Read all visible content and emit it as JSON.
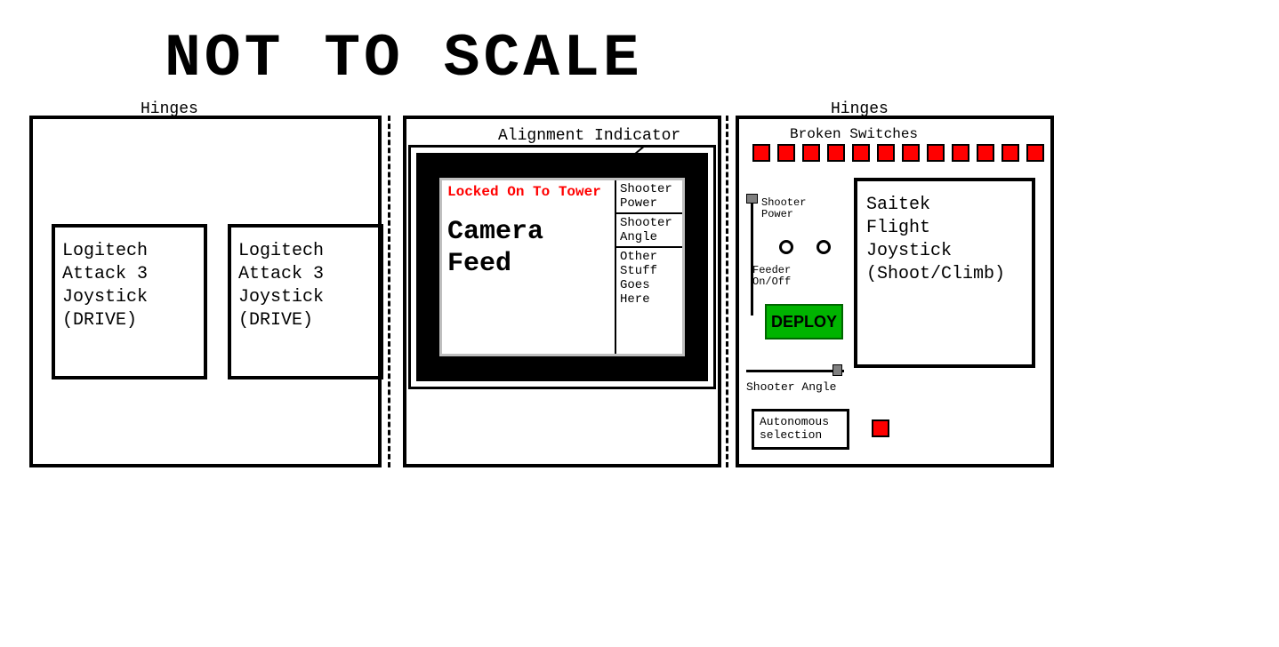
{
  "title": "NOT TO SCALE",
  "hinges_label": "Hinges",
  "joystick_drive": "Logitech\nAttack 3\nJoystick\n(DRIVE)",
  "center": {
    "align_label": "Alignment Indicator",
    "locked": "Locked On To Tower",
    "camera_feed": "Camera\nFeed",
    "side": {
      "shooter_power": "Shooter\nPower",
      "shooter_angle": "Shooter\nAngle",
      "other": "Other\nStuff\nGoes\nHere"
    }
  },
  "right": {
    "broken_switches": "Broken Switches",
    "switch_count": 12,
    "vslider_label": "Shooter\nPower",
    "feeder_label": "Feeder\nOn/Off",
    "deploy": "DEPLOY",
    "hslider_label": "Shooter Angle",
    "saitek": "Saitek\nFlight\nJoystick\n(Shoot/Climb)",
    "autonomous": "Autonomous\nselection"
  }
}
